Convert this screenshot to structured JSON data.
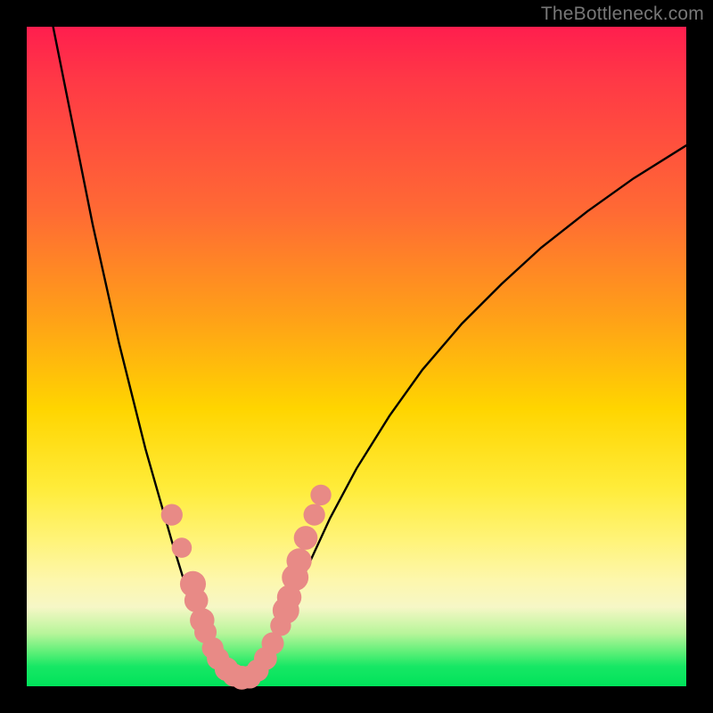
{
  "watermark": "TheBottleneck.com",
  "colors": {
    "curve": "#000000",
    "marker_fill": "#e88a86",
    "marker_stroke": "#d06a66",
    "gradient_top": "#ff1e4e",
    "gradient_bottom": "#00e35a"
  },
  "chart_data": {
    "type": "line",
    "title": "",
    "xlabel": "",
    "ylabel": "",
    "xlim": [
      0,
      100
    ],
    "ylim": [
      0,
      100
    ],
    "grid": false,
    "legend": false,
    "note": "No numeric axis ticks or labels are shown. x/y values are estimated from pixel positions on a 0–100 normalized scale (x left→right, y bottom→top).",
    "series": [
      {
        "name": "left-arm",
        "x": [
          4,
          6,
          8,
          10,
          12,
          14,
          16,
          18,
          20,
          22,
          24,
          25,
          26,
          27,
          28,
          29,
          30
        ],
        "y": [
          100,
          90,
          80,
          70,
          61,
          52,
          44,
          36,
          29,
          22,
          15.5,
          12.5,
          10,
          7.5,
          5.5,
          3.8,
          2.5
        ]
      },
      {
        "name": "valley-floor",
        "x": [
          30,
          31,
          32,
          33,
          34
        ],
        "y": [
          2.5,
          1.5,
          1.2,
          1.2,
          1.5
        ]
      },
      {
        "name": "right-arm",
        "x": [
          34,
          36,
          38,
          40,
          43,
          46,
          50,
          55,
          60,
          66,
          72,
          78,
          85,
          92,
          100
        ],
        "y": [
          1.5,
          4,
          8,
          12.5,
          19,
          25.5,
          33,
          41,
          48,
          55,
          61,
          66.5,
          72,
          77,
          82
        ]
      }
    ],
    "markers": {
      "name": "highlighted-points",
      "description": "salmon circular markers clustered around the minimum",
      "points": [
        {
          "x": 22.0,
          "y": 26.0,
          "r": 1.5
        },
        {
          "x": 23.5,
          "y": 21.0,
          "r": 1.3
        },
        {
          "x": 25.2,
          "y": 15.5,
          "r": 2.1
        },
        {
          "x": 25.7,
          "y": 13.0,
          "r": 1.8
        },
        {
          "x": 26.6,
          "y": 10.0,
          "r": 1.9
        },
        {
          "x": 27.1,
          "y": 8.2,
          "r": 1.6
        },
        {
          "x": 28.2,
          "y": 5.8,
          "r": 1.5
        },
        {
          "x": 29.0,
          "y": 4.2,
          "r": 1.6
        },
        {
          "x": 30.3,
          "y": 2.6,
          "r": 1.8
        },
        {
          "x": 31.4,
          "y": 1.7,
          "r": 1.7
        },
        {
          "x": 32.6,
          "y": 1.3,
          "r": 1.8
        },
        {
          "x": 33.8,
          "y": 1.4,
          "r": 1.7
        },
        {
          "x": 35.0,
          "y": 2.4,
          "r": 1.6
        },
        {
          "x": 36.2,
          "y": 4.2,
          "r": 1.7
        },
        {
          "x": 37.3,
          "y": 6.5,
          "r": 1.6
        },
        {
          "x": 38.5,
          "y": 9.2,
          "r": 1.4
        },
        {
          "x": 39.3,
          "y": 11.5,
          "r": 2.2
        },
        {
          "x": 39.8,
          "y": 13.5,
          "r": 1.9
        },
        {
          "x": 40.7,
          "y": 16.5,
          "r": 2.2
        },
        {
          "x": 41.3,
          "y": 19.0,
          "r": 2.0
        },
        {
          "x": 42.3,
          "y": 22.5,
          "r": 1.8
        },
        {
          "x": 43.6,
          "y": 26.0,
          "r": 1.5
        },
        {
          "x": 44.6,
          "y": 29.0,
          "r": 1.4
        }
      ]
    }
  }
}
